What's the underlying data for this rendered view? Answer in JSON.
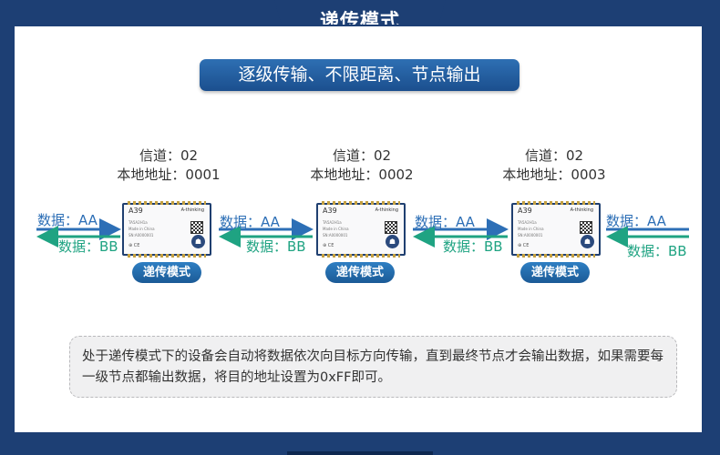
{
  "title": "递传模式",
  "subtitle": "逐级传输、不限距离、节点输出",
  "nodes": [
    {
      "channel": "信道：02",
      "address": "本地地址：0001",
      "badge": "递传模式"
    },
    {
      "channel": "信道：02",
      "address": "本地地址：0002",
      "badge": "递传模式"
    },
    {
      "channel": "信道：02",
      "address": "本地地址：0003",
      "badge": "递传模式"
    }
  ],
  "module": {
    "name": "A39",
    "brand": "A-thinking",
    "line1": "TA5A2H1a",
    "line2": "Made in China",
    "line3": "SN:A0000001",
    "logo": "☗",
    "marks": "⊕ CE"
  },
  "data_labels": {
    "aa": "数据：AA",
    "bb": "数据：BB"
  },
  "note": "处于递传模式下的设备会自动将数据依次向目标方向传输，直到最终节点才会输出数据，如果需要每一级节点都输出数据，将目的地址设置为0xFF即可。",
  "colors": {
    "navy": "#1d3f74",
    "aa_arrow": "#2d6fb6",
    "bb_arrow": "#1fa382"
  }
}
